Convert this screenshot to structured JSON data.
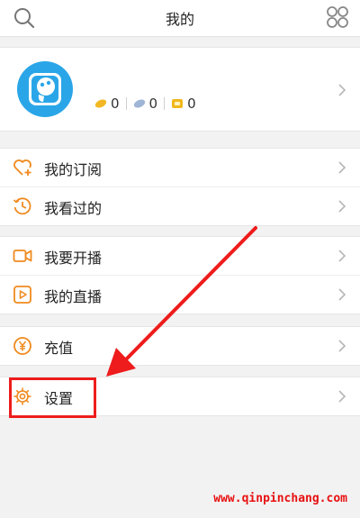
{
  "header": {
    "title": "我的",
    "left_icon": "search-icon",
    "right_icon": "grid-menu-icon"
  },
  "profile": {
    "avatar_icon": "avatar-icon",
    "stats": [
      {
        "icon": "gold-bean-icon",
        "value": "0",
        "color": "#f2b824"
      },
      {
        "icon": "silver-bean-icon",
        "value": "0",
        "color": "#9fb5d6"
      },
      {
        "icon": "coupon-icon",
        "value": "0",
        "color": "#f0b81c"
      }
    ]
  },
  "menu": {
    "group1": [
      {
        "label": "我的订阅",
        "icon": "heart-plus-icon"
      },
      {
        "label": "我看过的",
        "icon": "clock-icon"
      }
    ],
    "group2": [
      {
        "label": "我要开播",
        "icon": "video-camera-icon"
      },
      {
        "label": "我的直播",
        "icon": "play-box-icon"
      }
    ],
    "group3": [
      {
        "label": "充值",
        "icon": "yen-circle-icon"
      }
    ],
    "group4": [
      {
        "label": "设置",
        "icon": "gear-icon"
      }
    ]
  },
  "annotation": {
    "color": "#ee1c1c",
    "watermark": "www.qinpinchang.com"
  },
  "colors": {
    "accent": "#f08a1e",
    "avatar": "#2aa6e8"
  }
}
